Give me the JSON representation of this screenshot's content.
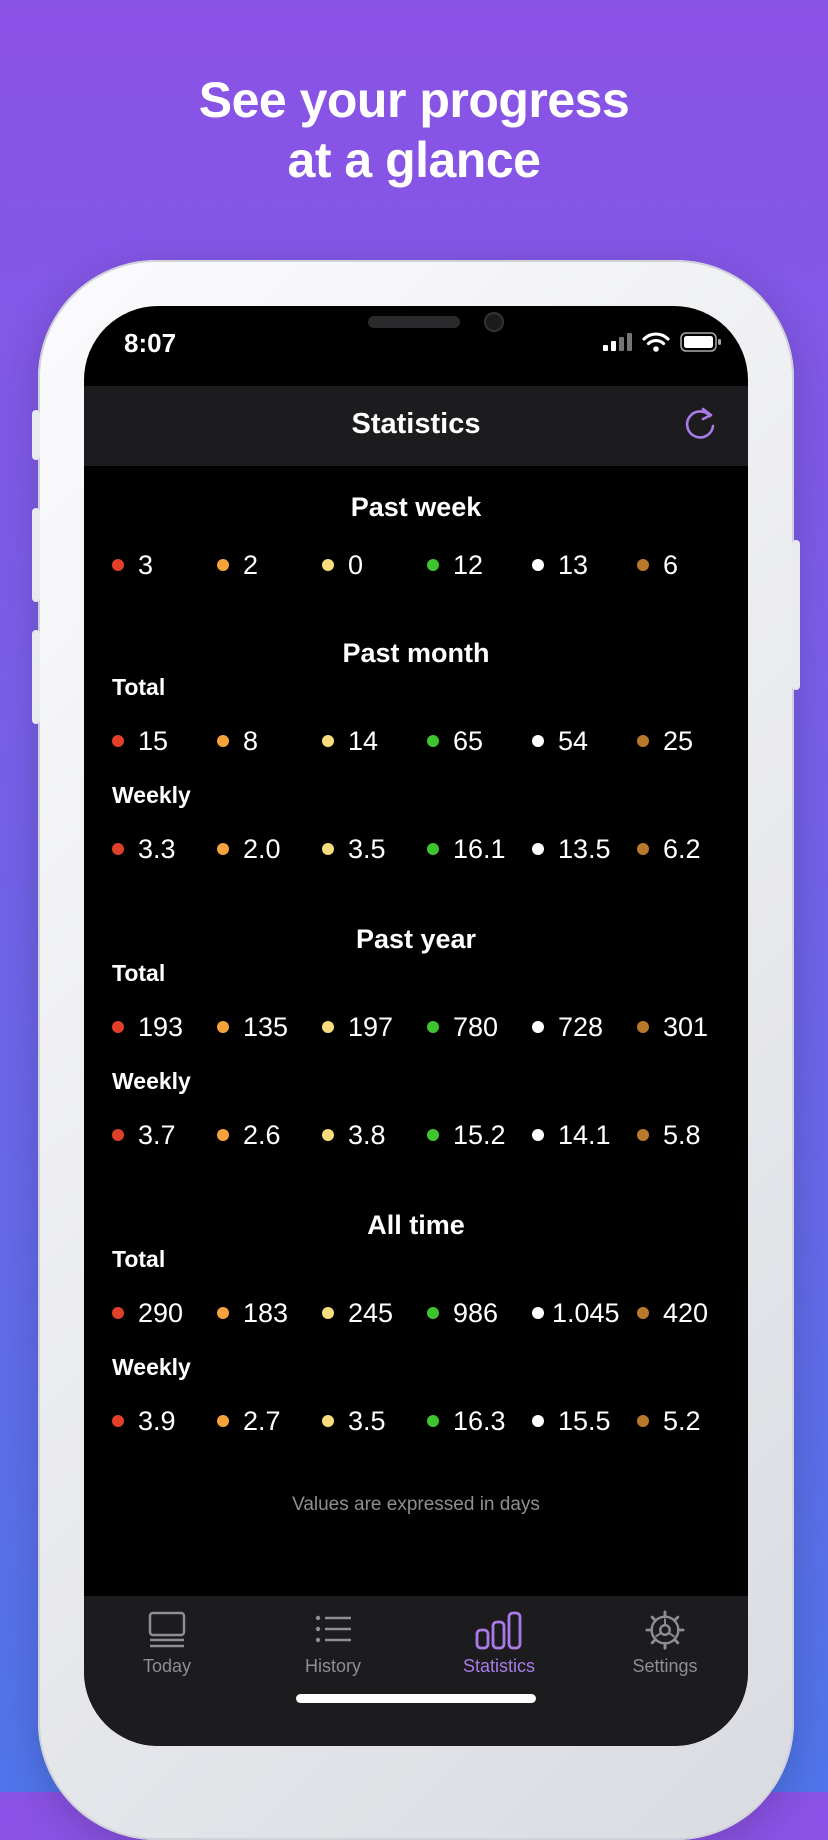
{
  "headline": {
    "line1": "See your progress",
    "line2": "at a glance"
  },
  "status_bar": {
    "time": "8:07"
  },
  "nav": {
    "title": "Statistics",
    "refresh_icon": "refresh-icon"
  },
  "colors": {
    "accent": "#a97be8",
    "red": "#e0402a",
    "orange": "#f5a33a",
    "yellow": "#f7dd7a",
    "green": "#3dc42f",
    "white": "#ffffff",
    "brown": "#b87a2a"
  },
  "past_week": {
    "title": "Past week",
    "values": [
      "3",
      "2",
      "0",
      "12",
      "13",
      "6"
    ]
  },
  "past_month": {
    "title": "Past month",
    "total_label": "Total",
    "total": [
      "15",
      "8",
      "14",
      "65",
      "54",
      "25"
    ],
    "weekly_label": "Weekly",
    "weekly": [
      "3.3",
      "2.0",
      "3.5",
      "16.1",
      "13.5",
      "6.2"
    ]
  },
  "past_year": {
    "title": "Past year",
    "total_label": "Total",
    "total": [
      "193",
      "135",
      "197",
      "780",
      "728",
      "301"
    ],
    "weekly_label": "Weekly",
    "weekly": [
      "3.7",
      "2.6",
      "3.8",
      "15.2",
      "14.1",
      "5.8"
    ]
  },
  "all_time": {
    "title": "All time",
    "total_label": "Total",
    "total": [
      "290",
      "183",
      "245",
      "986",
      "1.045",
      "420"
    ],
    "weekly_label": "Weekly",
    "weekly": [
      "3.9",
      "2.7",
      "3.5",
      "16.3",
      "15.5",
      "5.2"
    ]
  },
  "footnote": "Values are expressed in days",
  "tabs": [
    {
      "label": "Today",
      "icon": "today-icon"
    },
    {
      "label": "History",
      "icon": "list-icon"
    },
    {
      "label": "Statistics",
      "icon": "bar-chart-icon",
      "active": true
    },
    {
      "label": "Settings",
      "icon": "gear-icon"
    }
  ]
}
